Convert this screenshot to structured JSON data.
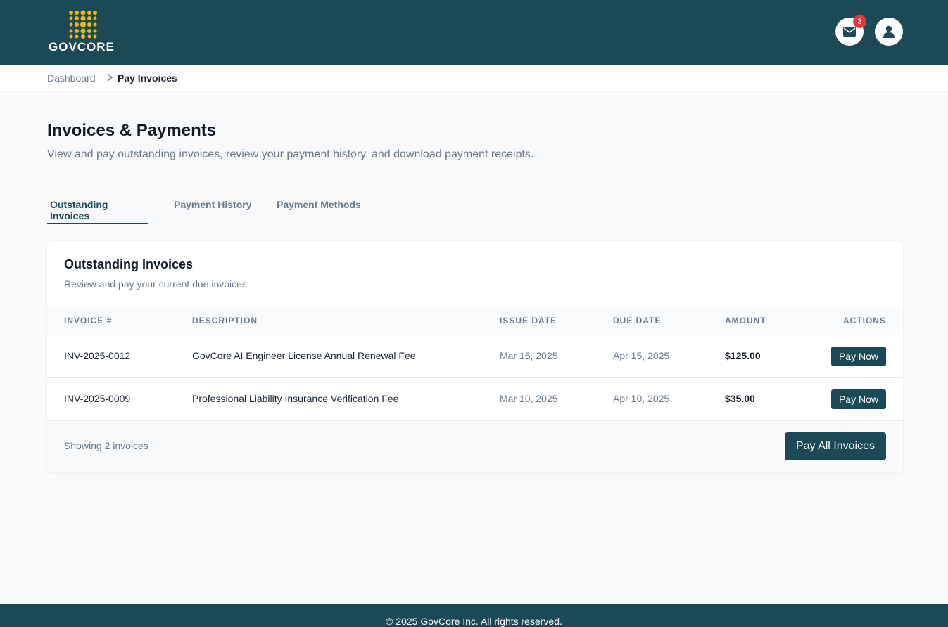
{
  "brand": {
    "name": "GOVCORE"
  },
  "header": {
    "mail_badge_count": "3",
    "icons": [
      "mail-icon",
      "user-icon"
    ],
    "accent": "#1b4a56",
    "badge_color": "#e5373b"
  },
  "breadcrumb": {
    "home": "Dashboard",
    "current": "Pay Invoices"
  },
  "page": {
    "title": "Invoices & Payments",
    "subtitle": "View and pay outstanding invoices, review your payment history, and download payment receipts."
  },
  "tabs": [
    {
      "label": "Outstanding Invoices",
      "active": true
    },
    {
      "label": "Payment History",
      "active": false
    },
    {
      "label": "Payment Methods",
      "active": false
    }
  ],
  "card": {
    "title": "Outstanding Invoices",
    "subtitle": "Review and pay your current due invoices.",
    "columns": [
      "Invoice #",
      "Description",
      "Issue Date",
      "Due Date",
      "Amount",
      "Actions"
    ],
    "rows": [
      {
        "invoice": "INV-2025-0012",
        "description": "GovCore AI Engineer License Annual Renewal Fee",
        "issue_date": "Mar 15, 2025",
        "due_date": "Apr 15, 2025",
        "amount": "$125.00",
        "action": "Pay Now"
      },
      {
        "invoice": "INV-2025-0009",
        "description": "Professional Liability Insurance Verification Fee",
        "issue_date": "Mar 10, 2025",
        "due_date": "Apr 10, 2025",
        "amount": "$35.00",
        "action": "Pay Now"
      }
    ],
    "footer_count": "Showing 2 invoices",
    "pay_all_label": "Pay All Invoices"
  },
  "footer": {
    "text": "© 2025 GovCore Inc. All rights reserved."
  }
}
